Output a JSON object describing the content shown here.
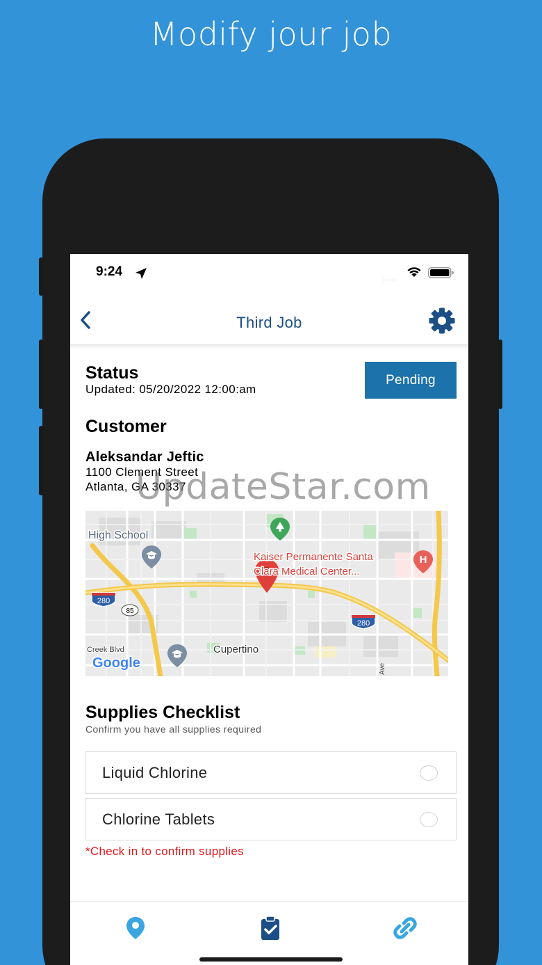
{
  "headline": "Modify jour job",
  "status_bar": {
    "time": "9:24",
    "signal": "....."
  },
  "nav": {
    "title": "Third Job"
  },
  "status": {
    "heading": "Status",
    "updated": "Updated: 05/20/2022 12:00:am",
    "button": "Pending"
  },
  "customer": {
    "heading": "Customer",
    "name": "Aleksandar Jeftic",
    "street": "1100 Clement Street",
    "city": "Atlanta, GA 30337"
  },
  "map": {
    "labels": {
      "school": "High School",
      "hospital_line1": "Kaiser Permanente Santa",
      "hospital_line2": "Clara Medical Center...",
      "city": "Cupertino",
      "street": "Creek Blvd",
      "ave": "Ave",
      "shield_280_a": "280",
      "shield_280_b": "280",
      "shield_85": "85",
      "brand": "Google"
    }
  },
  "watermark": "UpdateStar.com",
  "supplies": {
    "heading": "Supplies Checklist",
    "subtitle": "Confirm you have all supplies required",
    "items": [
      {
        "label": "Liquid Chlorine",
        "checked": false
      },
      {
        "label": "Chlorine Tablets",
        "checked": false
      }
    ],
    "warning": "*Check in to confirm supplies"
  },
  "tabs": [
    {
      "icon": "map-pin-icon",
      "active": false
    },
    {
      "icon": "clipboard-check-icon",
      "active": true
    },
    {
      "icon": "link-icon",
      "active": false
    }
  ],
  "colors": {
    "background": "#3393d9",
    "nav_title": "#1c4f86",
    "button": "#1c72aa",
    "warning": "#e2171d",
    "tab_inactive": "#3aa6e0",
    "tab_active": "#1c4f86"
  }
}
